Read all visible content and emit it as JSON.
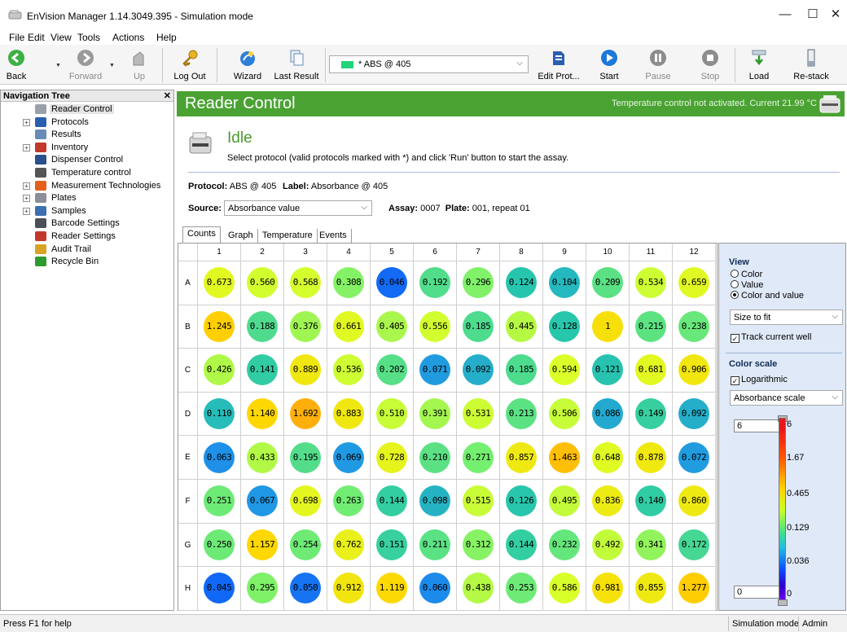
{
  "window": {
    "title": "EnVision Manager 1.14.3049.395 - Simulation mode"
  },
  "menu": [
    "File",
    "Edit",
    "View",
    "Tools",
    "Actions",
    "Help"
  ],
  "toolbar": {
    "back": "Back",
    "forward": "Forward",
    "up": "Up",
    "logout": "Log Out",
    "wizard": "Wizard",
    "last_result": "Last Result",
    "protocol_selected": "* ABS @ 405",
    "edit_protocol": "Edit Prot...",
    "start": "Start",
    "pause": "Pause",
    "stop": "Stop",
    "load": "Load",
    "restack": "Re-stack"
  },
  "nav": {
    "title": "Navigation Tree",
    "items": [
      {
        "label": "Reader Control",
        "icon": "reader-icon"
      },
      {
        "label": "Protocols",
        "icon": "protocol-icon",
        "expandable": true
      },
      {
        "label": "Results",
        "icon": "results-icon"
      },
      {
        "label": "Inventory",
        "icon": "inventory-icon",
        "expandable": true
      },
      {
        "label": "Dispenser Control",
        "icon": "dispenser-icon"
      },
      {
        "label": "Temperature control",
        "icon": "thermometer-icon"
      },
      {
        "label": "Measurement Technologies",
        "icon": "measurement-icon",
        "expandable": true
      },
      {
        "label": "Plates",
        "icon": "plates-icon",
        "expandable": true
      },
      {
        "label": "Samples",
        "icon": "samples-icon",
        "expandable": true
      },
      {
        "label": "Barcode Settings",
        "icon": "barcode-icon"
      },
      {
        "label": "Reader Settings",
        "icon": "reader-settings-icon"
      },
      {
        "label": "Audit Trail",
        "icon": "audit-trail-icon"
      },
      {
        "label": "Recycle Bin",
        "icon": "recycle-bin-icon"
      }
    ]
  },
  "main": {
    "title": "Reader Control",
    "temperature_text": "Temperature control not activated. Current 21.99 °C",
    "state": "Idle",
    "instruction": "Select protocol (valid protocols marked with *) and click 'Run' button to start the assay.",
    "protocol_label": "Protocol:",
    "protocol_value": "ABS @ 405",
    "label_label": "Label:",
    "label_value": "Absorbance @ 405",
    "source_label": "Source:",
    "source_value": "Absorbance value",
    "assay_label": "Assay:",
    "assay_value": "0007",
    "plate_label": "Plate:",
    "plate_value": "001,  repeat 01",
    "tabs": [
      "Counts",
      "Graph",
      "Temperature",
      "Events"
    ]
  },
  "plate": {
    "columns": [
      "1",
      "2",
      "3",
      "4",
      "5",
      "6",
      "7",
      "8",
      "9",
      "10",
      "11",
      "12"
    ],
    "rows": [
      "A",
      "B",
      "C",
      "D",
      "E",
      "F",
      "G",
      "H"
    ],
    "values": [
      [
        "0.673",
        "0.560",
        "0.568",
        "0.308",
        "0.046",
        "0.192",
        "0.296",
        "0.124",
        "0.104",
        "0.209",
        "0.534",
        "0.659"
      ],
      [
        "1.245",
        "0.188",
        "0.376",
        "0.661",
        "0.405",
        "0.556",
        "0.185",
        "0.445",
        "0.128",
        "1",
        "0.215",
        "0.238"
      ],
      [
        "0.426",
        "0.141",
        "0.889",
        "0.536",
        "0.202",
        "0.071",
        "0.092",
        "0.185",
        "0.594",
        "0.121",
        "0.681",
        "0.906"
      ],
      [
        "0.110",
        "1.140",
        "1.692",
        "0.883",
        "0.510",
        "0.391",
        "0.531",
        "0.213",
        "0.506",
        "0.086",
        "0.149",
        "0.092"
      ],
      [
        "0.063",
        "0.433",
        "0.195",
        "0.069",
        "0.728",
        "0.210",
        "0.271",
        "0.857",
        "1.463",
        "0.648",
        "0.878",
        "0.072"
      ],
      [
        "0.251",
        "0.067",
        "0.698",
        "0.263",
        "0.144",
        "0.098",
        "0.515",
        "0.126",
        "0.495",
        "0.836",
        "0.140",
        "0.860"
      ],
      [
        "0.250",
        "1.157",
        "0.254",
        "0.762",
        "0.151",
        "0.211",
        "0.312",
        "0.144",
        "0.232",
        "0.492",
        "0.341",
        "0.172"
      ],
      [
        "0.045",
        "0.295",
        "0.050",
        "0.912",
        "1.119",
        "0.060",
        "0.438",
        "0.253",
        "0.586",
        "0.981",
        "0.855",
        "1.277"
      ]
    ]
  },
  "view_panel": {
    "view_title": "View",
    "options": [
      "Color",
      "Value",
      "Color and value"
    ],
    "selected_option": "Color and value",
    "size_mode": "Size to fit",
    "track_current_well": "Track current well",
    "color_scale_title": "Color scale",
    "logarithmic": "Logarithmic",
    "scale_name": "Absorbance scale",
    "scale_max": "6",
    "scale_min": "0",
    "ticks": [
      "6",
      "1.67",
      "0.465",
      "0.129",
      "0.036",
      "0"
    ]
  },
  "statusbar": {
    "help": "Press F1 for help",
    "mode": "Simulation mode",
    "user": "Admin"
  }
}
